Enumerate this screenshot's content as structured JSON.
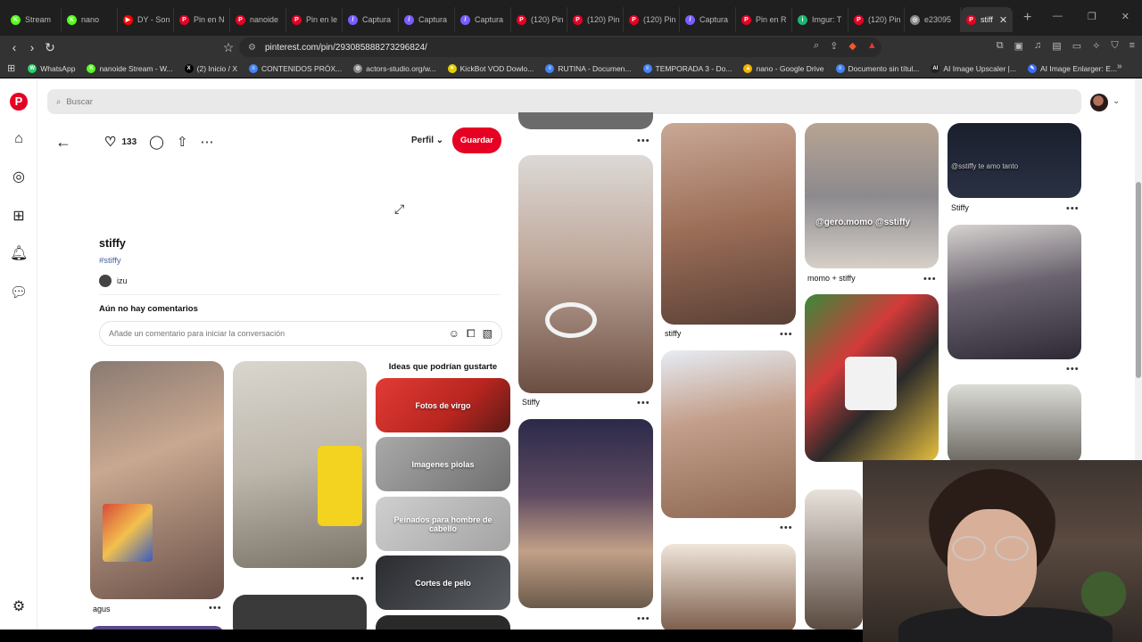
{
  "browser": {
    "tabs": [
      {
        "label": "Stream",
        "color": "#53fc18",
        "glyph": "K"
      },
      {
        "label": "nano",
        "color": "#53fc18",
        "glyph": "K"
      },
      {
        "label": "DY - Son",
        "color": "#ff0000",
        "glyph": "▶"
      },
      {
        "label": "Pin en N",
        "color": "#e60023",
        "glyph": "P"
      },
      {
        "label": "nanoide",
        "color": "#e60023",
        "glyph": "P"
      },
      {
        "label": "Pin en le",
        "color": "#e60023",
        "glyph": "P"
      },
      {
        "label": "Captura",
        "color": "#7a5cff",
        "glyph": "/"
      },
      {
        "label": "Captura",
        "color": "#7a5cff",
        "glyph": "/"
      },
      {
        "label": "Captura",
        "color": "#7a5cff",
        "glyph": "/"
      },
      {
        "label": "(120) Pin",
        "color": "#e60023",
        "glyph": "P"
      },
      {
        "label": "(120) Pin",
        "color": "#e60023",
        "glyph": "P"
      },
      {
        "label": "(120) Pin",
        "color": "#e60023",
        "glyph": "P"
      },
      {
        "label": "Captura",
        "color": "#7a5cff",
        "glyph": "/"
      },
      {
        "label": "Pin en R",
        "color": "#e60023",
        "glyph": "P"
      },
      {
        "label": "Imgur: T",
        "color": "#1bb76e",
        "glyph": "i"
      },
      {
        "label": "(120) Pin",
        "color": "#e60023",
        "glyph": "P"
      },
      {
        "label": "e23095",
        "color": "#888888",
        "glyph": "◎"
      }
    ],
    "active_tab": {
      "label": "stiff",
      "color": "#e60023",
      "glyph": "P"
    },
    "url": "pinterest.com/pin/293085888273296824/",
    "bookmarks": [
      {
        "label": "WhatsApp",
        "color": "#25d366",
        "glyph": "W"
      },
      {
        "label": "nanoide Stream - W...",
        "color": "#53fc18",
        "glyph": "K"
      },
      {
        "label": "(2) Inicio / X",
        "color": "#000000",
        "glyph": "X"
      },
      {
        "label": "CONTENIDOS PRÓX...",
        "color": "#4285f4",
        "glyph": "≡"
      },
      {
        "label": "actors-studio.org/w...",
        "color": "#888888",
        "glyph": "◎"
      },
      {
        "label": "KickBot VOD Dowlo...",
        "color": "#e4d000",
        "glyph": "✦"
      },
      {
        "label": "RUTINA - Documen...",
        "color": "#4285f4",
        "glyph": "≡"
      },
      {
        "label": "TEMPORADA 3 - Do...",
        "color": "#4285f4",
        "glyph": "≡"
      },
      {
        "label": "nano - Google Drive",
        "color": "#f4b400",
        "glyph": "▲"
      },
      {
        "label": "Documento sin títul...",
        "color": "#4285f4",
        "glyph": "≡"
      },
      {
        "label": "AI Image Upscaler |...",
        "color": "#222222",
        "glyph": "AI"
      },
      {
        "label": "AI Image Enlarger: E...",
        "color": "#3b6cff",
        "glyph": "✎"
      }
    ]
  },
  "search": {
    "placeholder": "Buscar"
  },
  "pin": {
    "likes": "133",
    "profile_label": "Perfil",
    "save_label": "Guardar",
    "title": "stiffy",
    "hashtag": "#stiffy",
    "author": "izu",
    "no_comments": "Aún no hay comentarios",
    "comment_placeholder": "Añade un comentario para iniciar la conversación"
  },
  "ideas": {
    "title": "Ideas que podrían gustarte",
    "items": [
      {
        "label": "Fotos de virgo",
        "bg": "#c7342e"
      },
      {
        "label": "Imagenes piolas",
        "bg": "#8f8f8f"
      },
      {
        "label": "Peinados para hombre de cabello",
        "bg": "#b9b9b9"
      },
      {
        "label": "Cortes de pelo",
        "bg": "#3c3f44"
      }
    ]
  },
  "grid": {
    "captions": {
      "agus": "agus",
      "stiffy_a": "Stiffy",
      "stiffy_b": "stiffy",
      "momo": "momo + stiffy",
      "stiffy_c": "Stiffy"
    },
    "overlays": {
      "gero": "@gero.momo @sstiffy",
      "sstiffy": "@sstiffy te amo tanto"
    },
    "more": "•••"
  }
}
